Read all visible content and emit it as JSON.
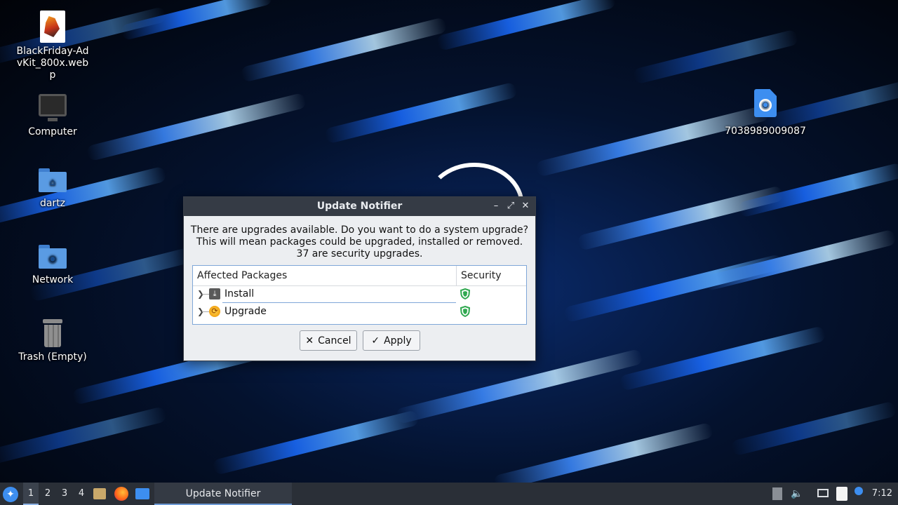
{
  "desktop": {
    "icons": [
      {
        "label": "BlackFriday-AdvKit_800x.webp",
        "icon": "image-file-icon"
      },
      {
        "label": "Computer",
        "icon": "computer-icon"
      },
      {
        "label": "dartz",
        "icon": "home-folder-icon"
      },
      {
        "label": "Network",
        "icon": "network-folder-icon"
      },
      {
        "label": "Trash (Empty)",
        "icon": "trash-icon"
      },
      {
        "label": "7038989009087",
        "icon": "web-file-icon"
      }
    ]
  },
  "dialog": {
    "title": "Update Notifier",
    "message_line1": "There are upgrades available. Do you want to do a system upgrade?",
    "message_line2": "This will mean packages could be upgraded, installed or removed.",
    "message_line3": "37 are security upgrades.",
    "columns": {
      "affected": "Affected Packages",
      "security": "Security"
    },
    "rows": [
      {
        "label": "Install",
        "icon": "download-icon",
        "security_icon": "shield-icon"
      },
      {
        "label": "Upgrade",
        "icon": "upgrade-icon",
        "security_icon": "shield-icon"
      }
    ],
    "buttons": {
      "cancel": "Cancel",
      "apply": "Apply"
    },
    "window_controls": {
      "minimize": "–",
      "maximize": "⤢",
      "close": "✕"
    }
  },
  "taskbar": {
    "workspaces": [
      "1",
      "2",
      "3",
      "4"
    ],
    "active_workspace": "1",
    "launchers": [
      "file-manager-icon",
      "firefox-icon",
      "desktop-icon"
    ],
    "task_label": "Update Notifier",
    "tray": [
      "notification-icon",
      "volume-icon",
      "network-icon",
      "clipboard-icon",
      "update-icon"
    ],
    "clock": "7:12"
  },
  "colors": {
    "accent": "#3d8ef0",
    "titlebar": "#353b45",
    "taskbar": "#2a2f37",
    "shield": "#2fa84f"
  }
}
